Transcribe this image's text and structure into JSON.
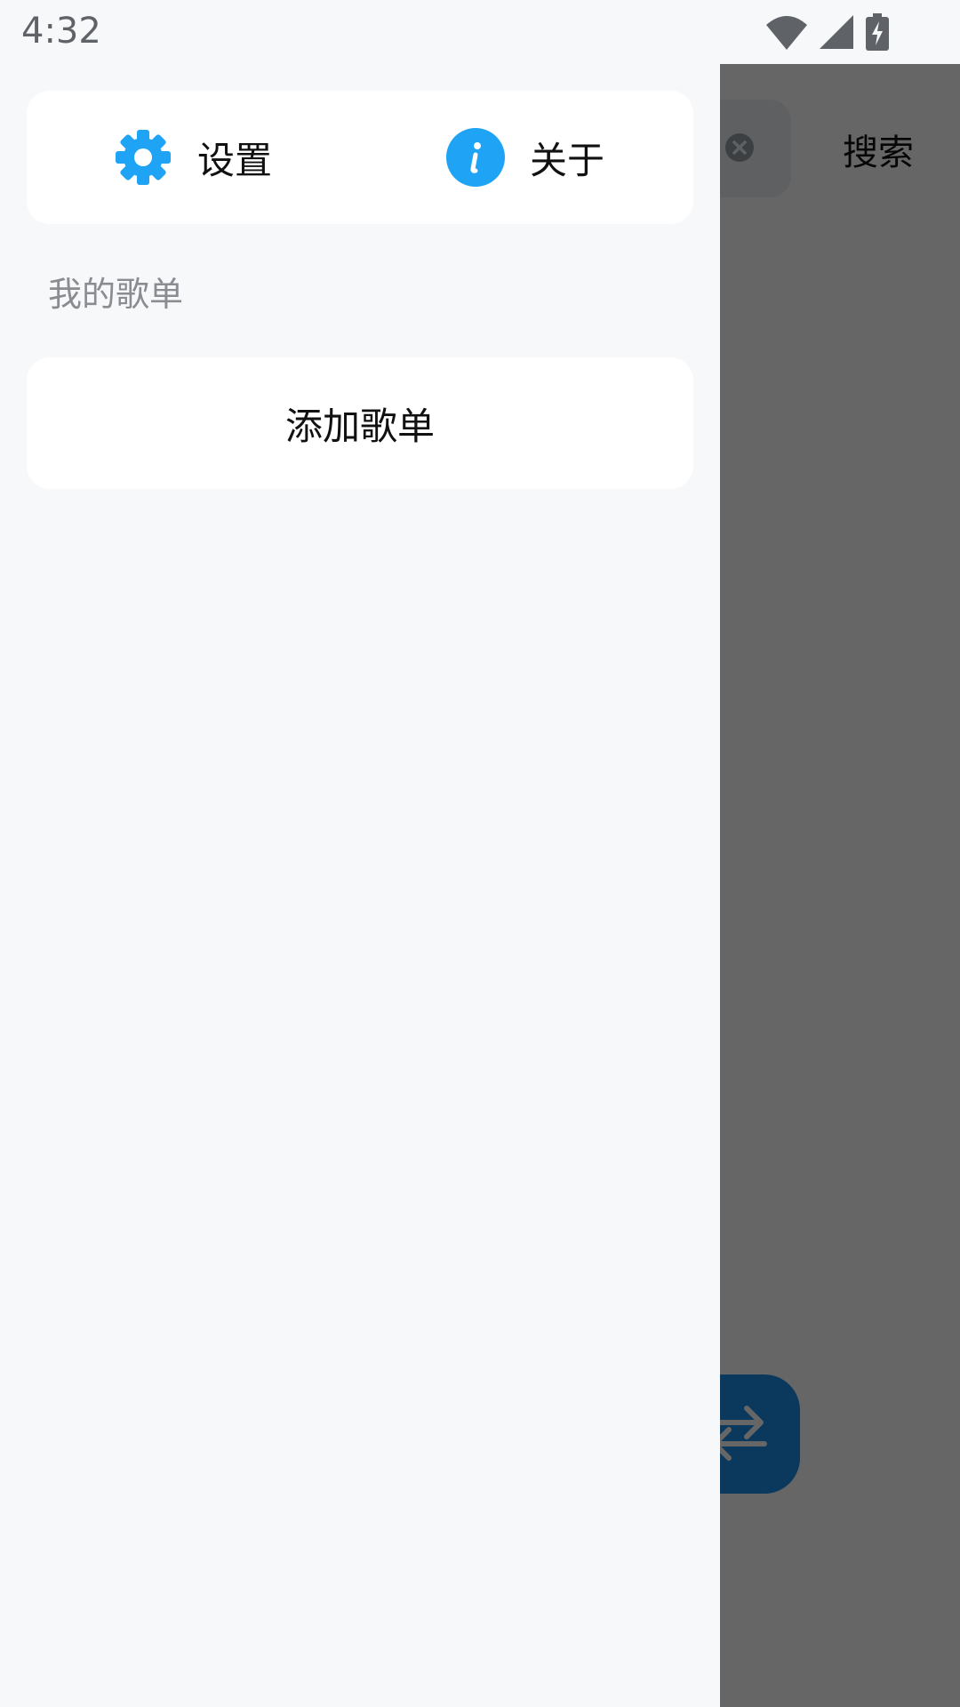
{
  "status_bar": {
    "time": "4:32",
    "icons": [
      "wifi-icon",
      "cell-signal-icon",
      "battery-charging-icon"
    ]
  },
  "drawer": {
    "actions": [
      {
        "label": "设置",
        "icon": "gear-icon"
      },
      {
        "label": "关于",
        "icon": "info-icon"
      }
    ],
    "section_title": "我的歌单",
    "add_playlist_label": "添加歌单"
  },
  "background_app": {
    "search_button_label": "搜索",
    "fab_icon": "shuffle-arrows-icon"
  },
  "colors": {
    "accent": "#1fa3f5",
    "drawer_background": "#f7f8fa",
    "card_background": "#ffffff",
    "scrim": "#666868"
  }
}
